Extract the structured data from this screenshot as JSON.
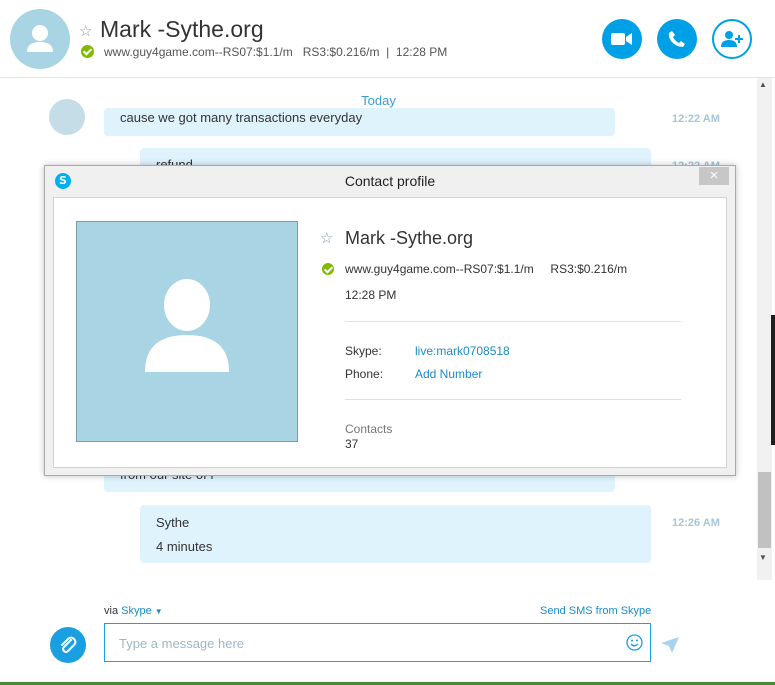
{
  "header": {
    "contact_name": "Mark -Sythe.org",
    "mood": "www.guy4game.com--RS07:$1.1/m   RS3:$0.216/m  |  12:28 PM",
    "buttons": {
      "video": "video-call",
      "call": "audio-call",
      "add": "add-people"
    }
  },
  "chat": {
    "date_separator": "Today",
    "messages": [
      {
        "text": "cause we got many transactions everyday",
        "time": "12:22 AM"
      },
      {
        "text": "refund",
        "time": "12:22 AM"
      },
      {
        "text": "from our site of f",
        "time": ""
      },
      {
        "line1": "Sythe",
        "line2": "4 minutes",
        "time": "12:26 AM"
      }
    ]
  },
  "dialog": {
    "title": "Contact profile",
    "logo_letter": "S",
    "close": "×",
    "name": "Mark -Sythe.org",
    "mood": "www.guy4game.com--RS07:$1.1/m     RS3:$0.216/m",
    "time": "12:28 PM",
    "skype_label": "Skype:",
    "skype_value": "live:mark0708518",
    "phone_label": "Phone:",
    "phone_value": "Add Number",
    "contacts_label": "Contacts",
    "contacts_value": "37"
  },
  "composer": {
    "via_prefix": "via ",
    "via_link": "Skype",
    "sms_link": "Send SMS from Skype",
    "placeholder": "Type a message here"
  },
  "colors": {
    "accent": "#00a0e6",
    "bubble": "#dff3fd",
    "online": "#7fba00"
  }
}
